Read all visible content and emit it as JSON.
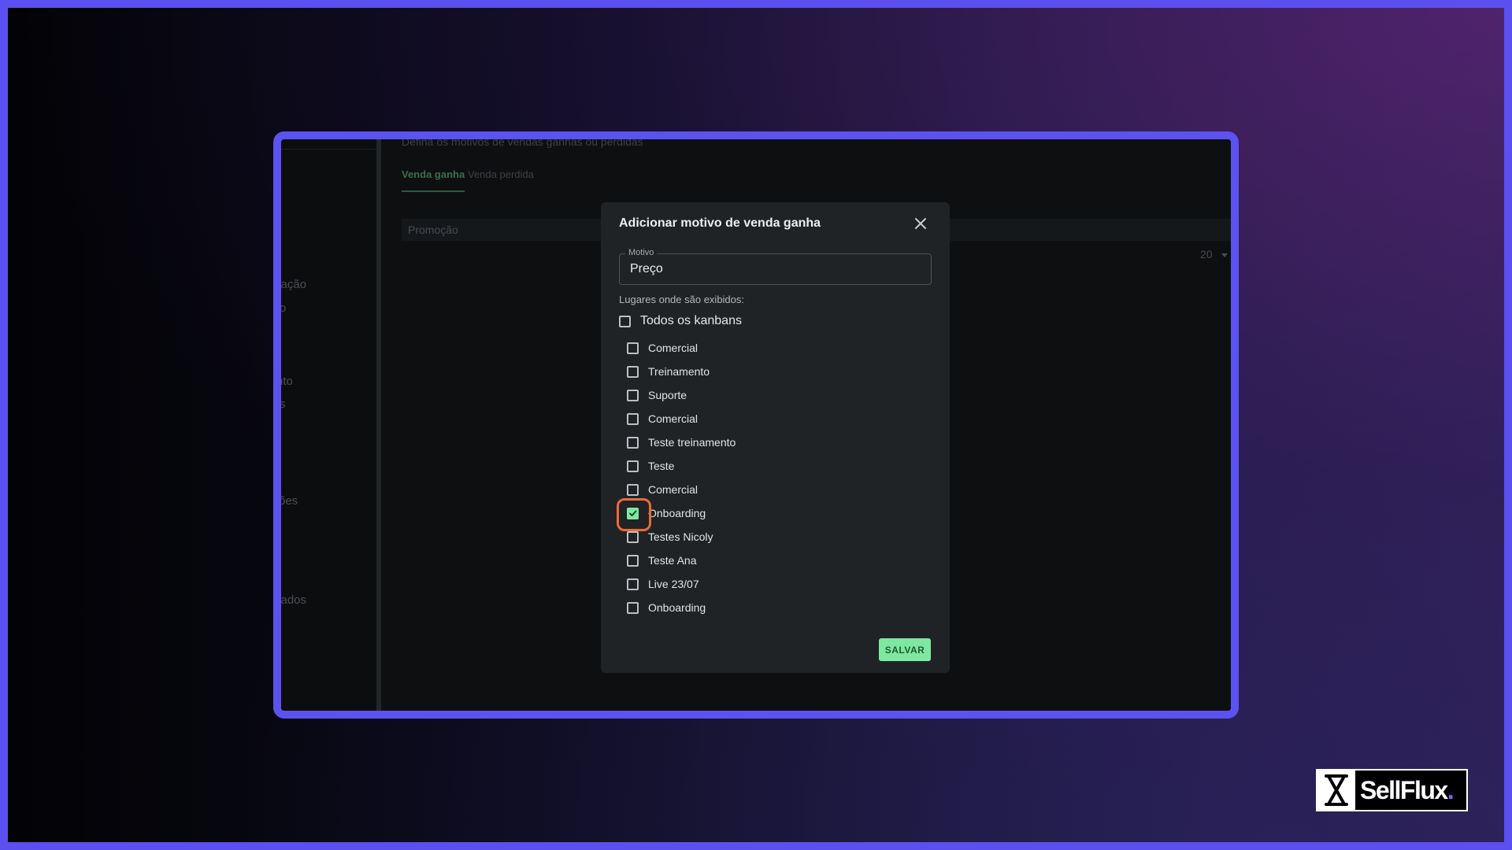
{
  "sidebar": {
    "items": [
      "cação",
      "o",
      "nto",
      "s",
      "rões",
      "cados"
    ]
  },
  "page": {
    "subtitle": "Defina os motivos de vendas ganhas ou perdidas",
    "tabs": [
      {
        "label": "Venda ganha",
        "active": true
      },
      {
        "label": "Venda perdida",
        "active": false
      }
    ],
    "list_rows": [
      "Promoção"
    ],
    "per_page": "20"
  },
  "modal": {
    "title": "Adicionar motivo de venda ganha",
    "field": {
      "label": "Motivo",
      "value": "Preço"
    },
    "places_label": "Lugares onde são exibidos:",
    "all_kanbans": {
      "label": "Todos os kanbans",
      "checked": false
    },
    "kanbans": [
      {
        "label": "Comercial",
        "checked": false
      },
      {
        "label": "Treinamento",
        "checked": false
      },
      {
        "label": "Suporte",
        "checked": false
      },
      {
        "label": "Comercial",
        "checked": false
      },
      {
        "label": "Teste treinamento",
        "checked": false
      },
      {
        "label": "Teste",
        "checked": false
      },
      {
        "label": "Comercial",
        "checked": false
      },
      {
        "label": "Onboarding",
        "checked": true
      },
      {
        "label": "Testes Nicoly",
        "checked": false
      },
      {
        "label": "Teste Ana",
        "checked": false
      },
      {
        "label": "Live 23/07",
        "checked": false
      },
      {
        "label": "Onboarding",
        "checked": false
      }
    ],
    "save_label": "SALVAR"
  },
  "logo": {
    "text": "SellFlux",
    "dot": "."
  },
  "colors": {
    "frame_border": "#5b52f0",
    "accent_green": "#7fe8a0",
    "highlight": "#ec6a3b"
  }
}
